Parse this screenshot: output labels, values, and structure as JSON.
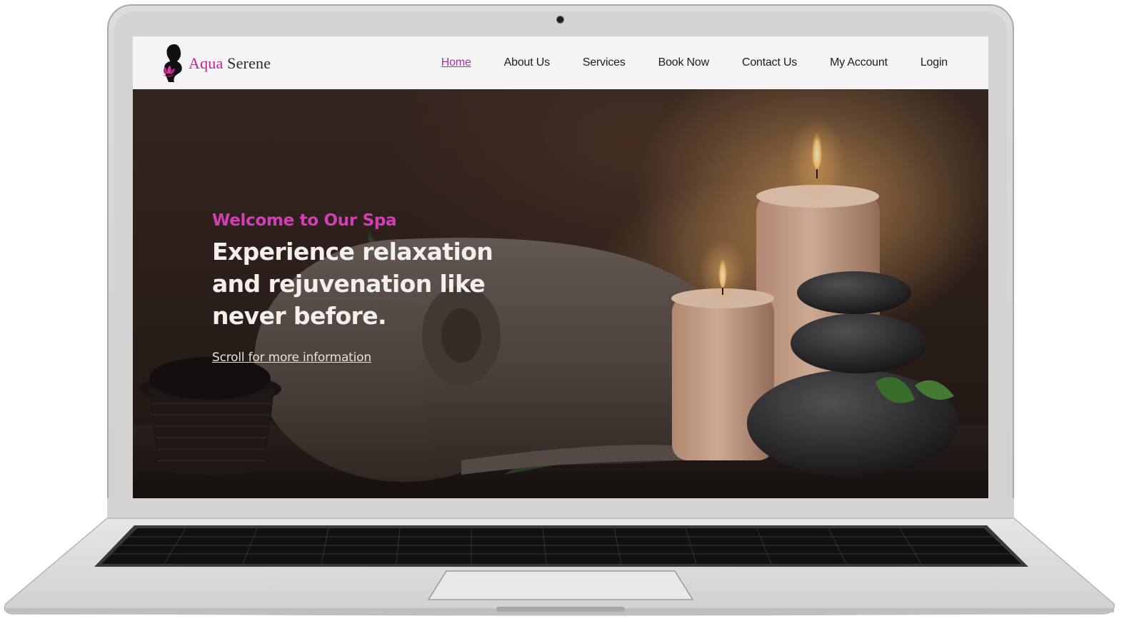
{
  "brand": {
    "name_part1": "Aqua",
    "name_part2": "Serene",
    "logo_icon": "woman-silhouette-lotus-icon"
  },
  "nav": {
    "items": [
      {
        "label": "Home",
        "active": true
      },
      {
        "label": "About Us",
        "active": false
      },
      {
        "label": "Services",
        "active": false
      },
      {
        "label": "Book Now",
        "active": false
      },
      {
        "label": "Contact Us",
        "active": false
      },
      {
        "label": "My Account",
        "active": false
      },
      {
        "label": "Login",
        "active": false
      }
    ]
  },
  "hero": {
    "kicker": "Welcome to Our Spa",
    "headline_line1": "Experience relaxation",
    "headline_line2": "and rejuvenation like",
    "headline_line3": "never before.",
    "scroll_link": "Scroll for more information",
    "image": "spa-towel-candles-stones-photo"
  },
  "colors": {
    "accent": "#d43db5",
    "nav_active": "#b52aa6",
    "header_bg": "#f4f4f5",
    "hero_text": "#f2efee"
  }
}
